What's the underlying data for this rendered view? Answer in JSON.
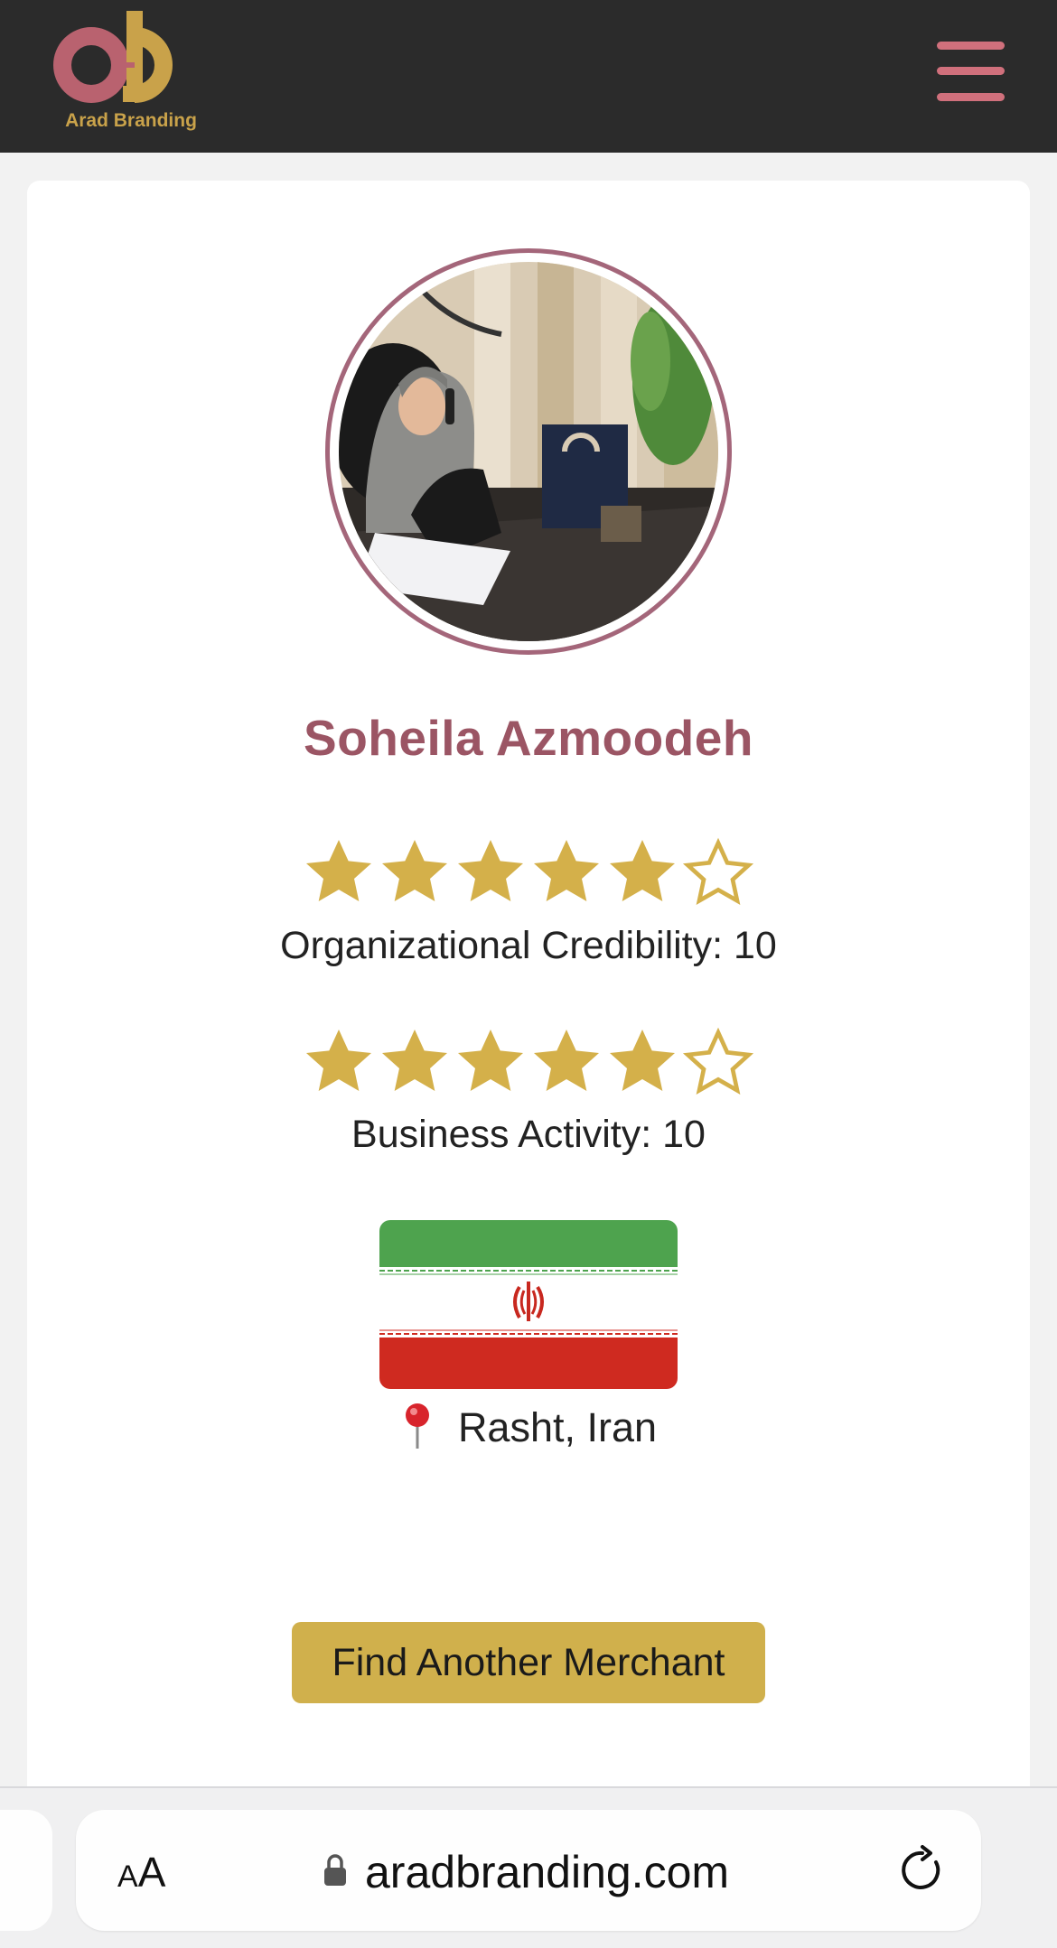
{
  "header": {
    "logo_text": "Arad Branding",
    "logo_icon": "arad-branding-logo",
    "menu_icon": "hamburger-menu-icon",
    "brand_colors": {
      "pink": "#b9626f",
      "gold": "#c9a24a",
      "bar": "#2b2b2b"
    }
  },
  "profile": {
    "avatar": "merchant-profile-photo",
    "name": "Soheila Azmoodeh",
    "ratings": [
      {
        "label": "Organizational Credibility: 10",
        "stars_filled": 5,
        "stars_total": 6
      },
      {
        "label": "Business Activity: 10",
        "stars_filled": 5,
        "stars_total": 6
      }
    ],
    "star_color": "#d4b04a",
    "flag": "iran-flag",
    "location_icon": "location-pin-icon",
    "location": "Rasht, Iran"
  },
  "actions": {
    "find_another_label": "Find Another Merchant",
    "button_color": "#d0b04c"
  },
  "browser": {
    "text_size_label_small": "A",
    "text_size_label_large": "A",
    "lock_icon": "lock-icon",
    "url": "aradbranding.com",
    "reload_icon": "reload-icon"
  }
}
